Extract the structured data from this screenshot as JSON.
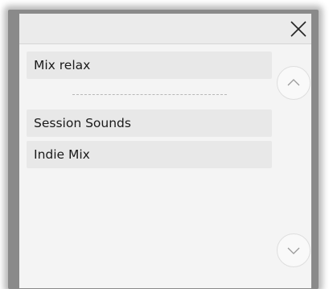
{
  "icons": {
    "close": "close-icon",
    "scroll_up": "chevron-up-icon",
    "scroll_down": "chevron-down-icon"
  },
  "colors": {
    "panel_background": "#f4f4f4",
    "item_background": "#e8e8e8",
    "text": "#1a1a1a"
  },
  "playlist": {
    "items": [
      {
        "label": "Mix relax"
      },
      {
        "label": "Session Sounds"
      },
      {
        "label": "Indie Mix"
      }
    ]
  }
}
